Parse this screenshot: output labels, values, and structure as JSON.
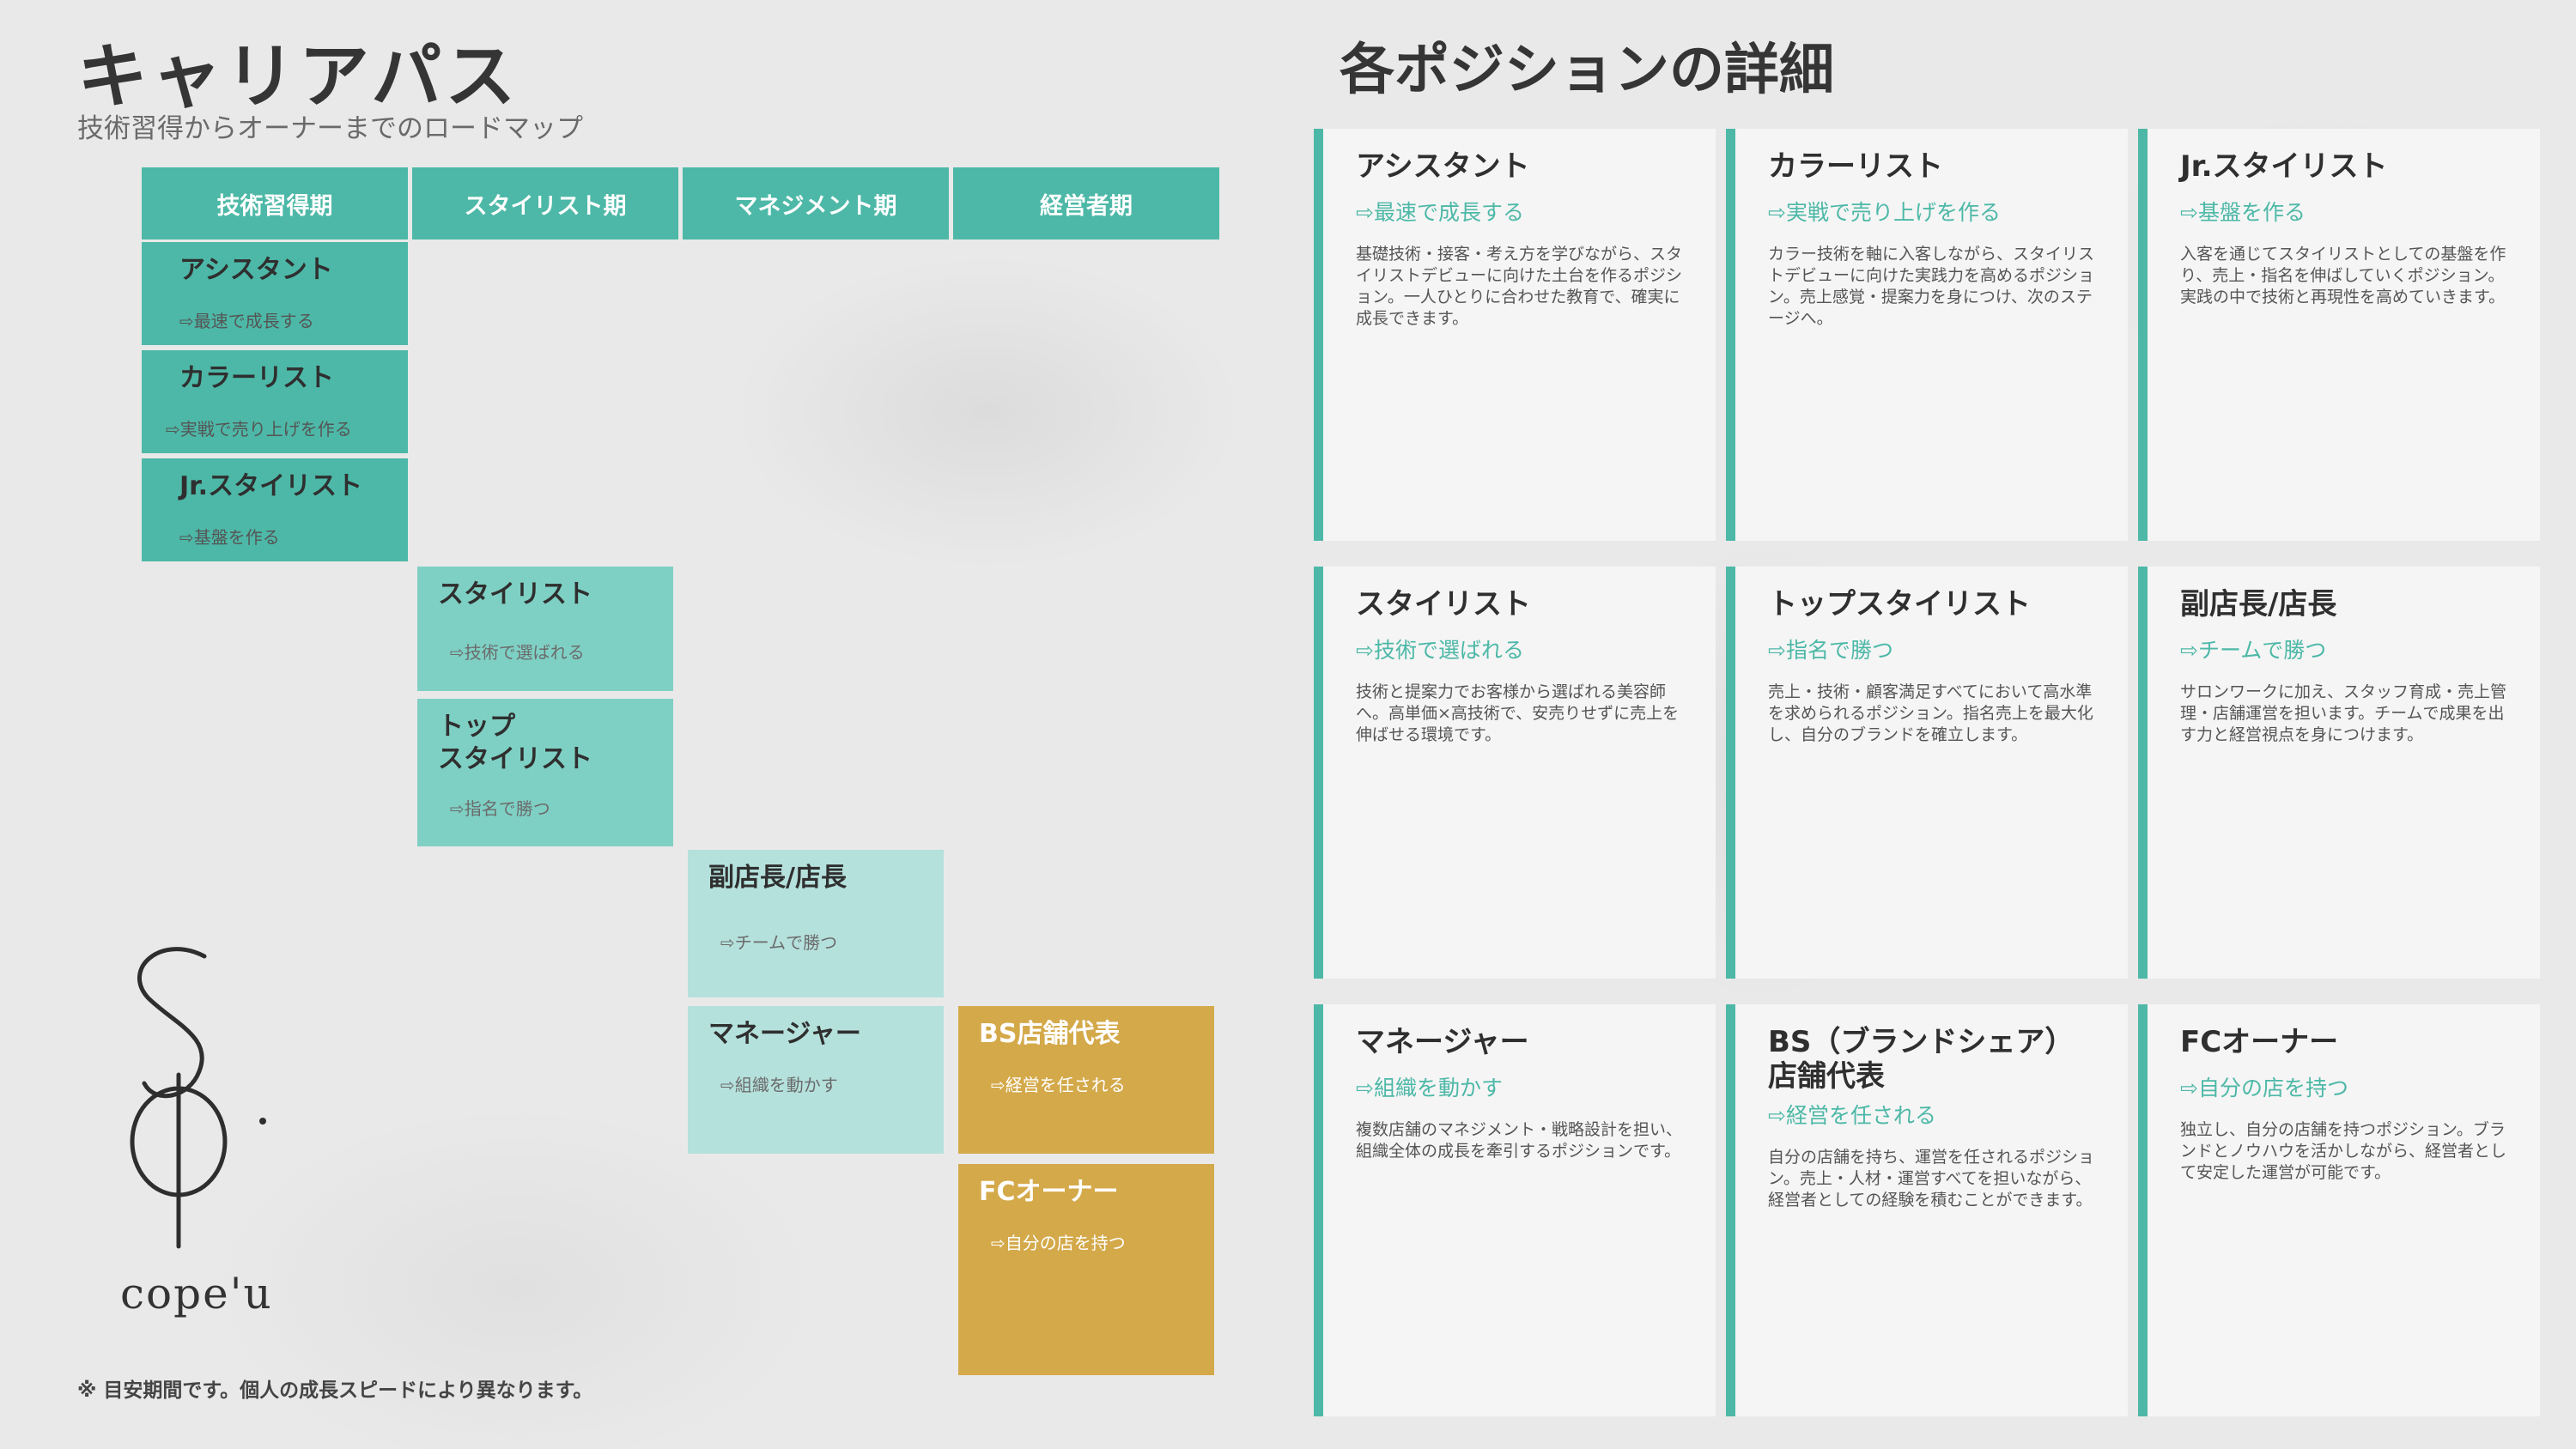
{
  "header": {
    "title": "キャリアパス",
    "subtitle": "技術習得からオーナーまでのロードマップ"
  },
  "phases": [
    "技術習得期",
    "スタイリスト期",
    "マネジメント期",
    "経営者期"
  ],
  "path": [
    {
      "name": "アシスタント",
      "tag": "⇨最速で成長する"
    },
    {
      "name": "カラーリスト",
      "tag": "⇨実戦で売り上げを作る"
    },
    {
      "name": "Jr.スタイリスト",
      "tag": "⇨基盤を作る"
    },
    {
      "name": "スタイリスト",
      "tag": "⇨技術で選ばれる"
    },
    {
      "name": "トップ\nスタイリスト",
      "tag": "⇨指名で勝つ"
    },
    {
      "name": "副店長/店長",
      "tag": "⇨チームで勝つ"
    },
    {
      "name": "マネージャー",
      "tag": "⇨組織を動かす"
    },
    {
      "name": "BS店舗代表",
      "tag": "⇨経営を任される"
    },
    {
      "name": "FCオーナー",
      "tag": "⇨自分の店を持つ"
    }
  ],
  "note": "※ 目安期間です。個人の成長スピードにより異なります。",
  "logo": {
    "text": "cope'u"
  },
  "details": {
    "title": "各ポジションの詳細",
    "cards": [
      {
        "name": "アシスタント",
        "tag": "⇨最速で成長する",
        "desc": "基礎技術・接客・考え方を学びながら、スタイリストデビューに向けた土台を作るポジション。一人ひとりに合わせた教育で、確実に成長できます。"
      },
      {
        "name": "カラーリスト",
        "tag": "⇨実戦で売り上げを作る",
        "desc": "カラー技術を軸に入客しながら、スタイリストデビューに向けた実践力を高めるポジション。売上感覚・提案力を身につけ、次のステージへ。"
      },
      {
        "name": "Jr.スタイリスト",
        "tag": "⇨基盤を作る",
        "desc": "入客を通じてスタイリストとしての基盤を作り、売上・指名を伸ばしていくポジション。実践の中で技術と再現性を高めていきます。"
      },
      {
        "name": "スタイリスト",
        "tag": "⇨技術で選ばれる",
        "desc": "技術と提案力でお客様から選ばれる美容師へ。高単価×高技術で、安売りせずに売上を伸ばせる環境です。"
      },
      {
        "name": "トップスタイリスト",
        "tag": "⇨指名で勝つ",
        "desc": "売上・技術・顧客満足すべてにおいて高水準を求められるポジション。指名売上を最大化し、自分のブランドを確立します。"
      },
      {
        "name": "副店長/店長",
        "tag": "⇨チームで勝つ",
        "desc": "サロンワークに加え、スタッフ育成・売上管理・店舗運営を担います。チームで成果を出す力と経営視点を身につけます。"
      },
      {
        "name": "マネージャー",
        "tag": "⇨組織を動かす",
        "desc": "複数店舗のマネジメント・戦略設計を担い、組織全体の成長を牽引するポジションです。"
      },
      {
        "name": "BS（ブランドシェア）\n店舗代表",
        "tag": "⇨経営を任される",
        "desc": "自分の店舗を持ち、運営を任されるポジション。売上・人材・運営すべてを担いながら、経営者としての経験を積むことができます。"
      },
      {
        "name": "FCオーナー",
        "tag": "⇨自分の店を持つ",
        "desc": "独立し、自分の店舗を持つポジション。ブランドとノウハウを活かしながら、経営者として安定した運営が可能です。"
      }
    ]
  }
}
